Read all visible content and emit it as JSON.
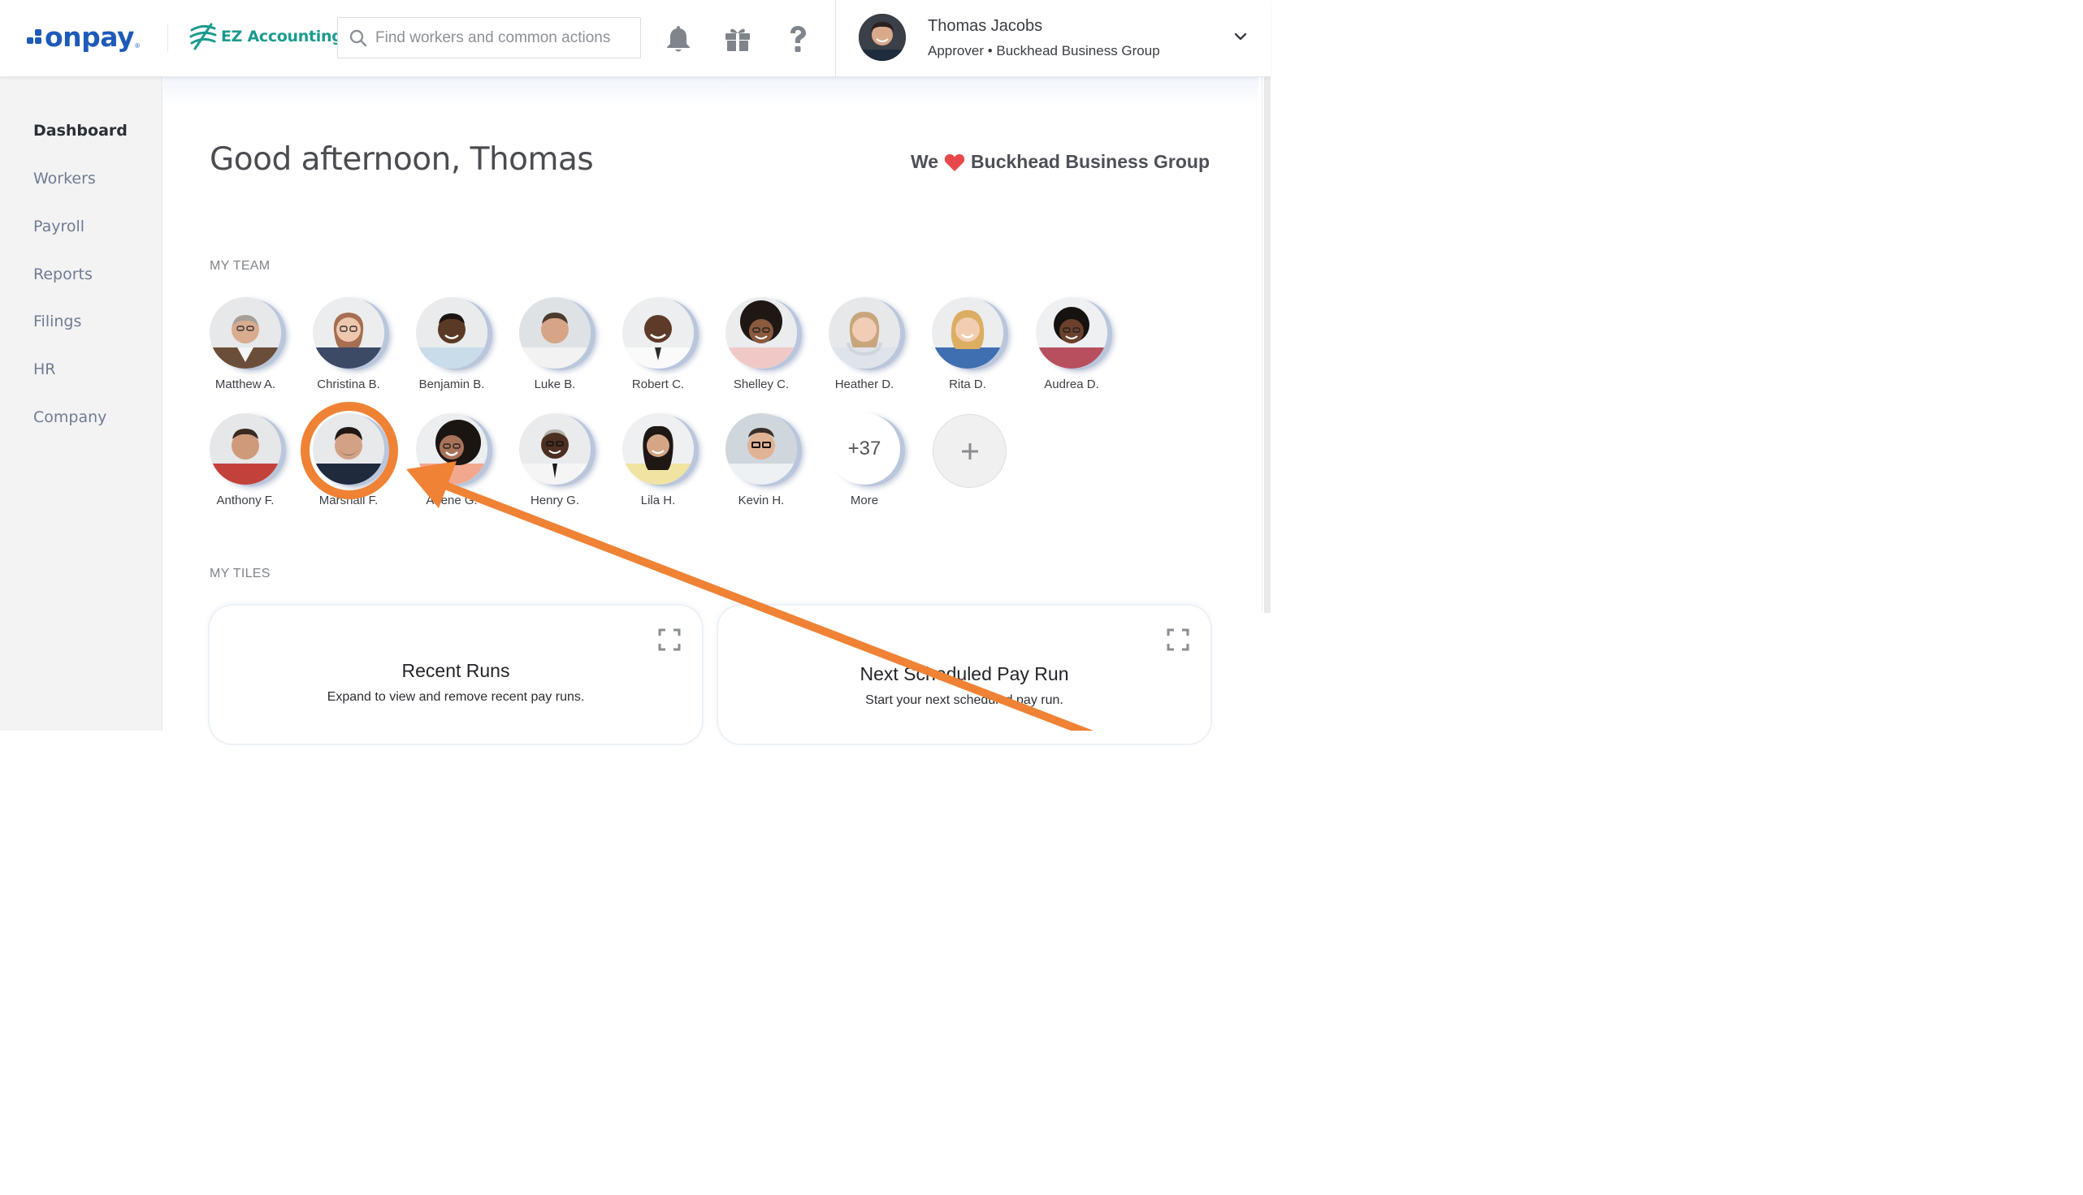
{
  "header": {
    "brand": "onpay",
    "integration": "EZ Accounting",
    "search": {
      "placeholder": "Find workers and common actions",
      "value": ""
    },
    "icons": [
      "bell-icon",
      "gift-icon",
      "help-icon"
    ],
    "user": {
      "name": "Thomas Jacobs",
      "role": "Approver • Buckhead Business Group"
    }
  },
  "sidebar": {
    "items": [
      {
        "label": "Dashboard",
        "active": true
      },
      {
        "label": "Workers",
        "active": false
      },
      {
        "label": "Payroll",
        "active": false
      },
      {
        "label": "Reports",
        "active": false
      },
      {
        "label": "Filings",
        "active": false
      },
      {
        "label": "HR",
        "active": false
      },
      {
        "label": "Company",
        "active": false
      }
    ]
  },
  "main": {
    "greeting": "Good afternoon, Thomas",
    "we": "We",
    "company": "Buckhead Business Group",
    "team_label": "MY TEAM",
    "team": [
      {
        "name": "Matthew A."
      },
      {
        "name": "Christina B."
      },
      {
        "name": "Benjamin B."
      },
      {
        "name": "Luke B."
      },
      {
        "name": "Robert C."
      },
      {
        "name": "Shelley C."
      },
      {
        "name": "Heather D."
      },
      {
        "name": "Rita D."
      },
      {
        "name": "Audrea D."
      },
      {
        "name": "Anthony F."
      },
      {
        "name": "Marshall F."
      },
      {
        "name": "Arlene G."
      },
      {
        "name": "Henry G."
      },
      {
        "name": "Lila H."
      },
      {
        "name": "Kevin H."
      }
    ],
    "more": {
      "count": "+37",
      "label": "More"
    },
    "tiles_label": "MY TILES",
    "tiles": [
      {
        "title": "Recent Runs",
        "description": "Expand to view and remove recent pay runs."
      },
      {
        "title": "Next Scheduled Pay Run",
        "description": "Start your next scheduled pay run."
      }
    ]
  },
  "colors": {
    "brand_blue": "#1d5ab9",
    "ez_teal": "#1b9b8f",
    "heart_red": "#e8484c",
    "annotation_orange": "#ef8234"
  }
}
